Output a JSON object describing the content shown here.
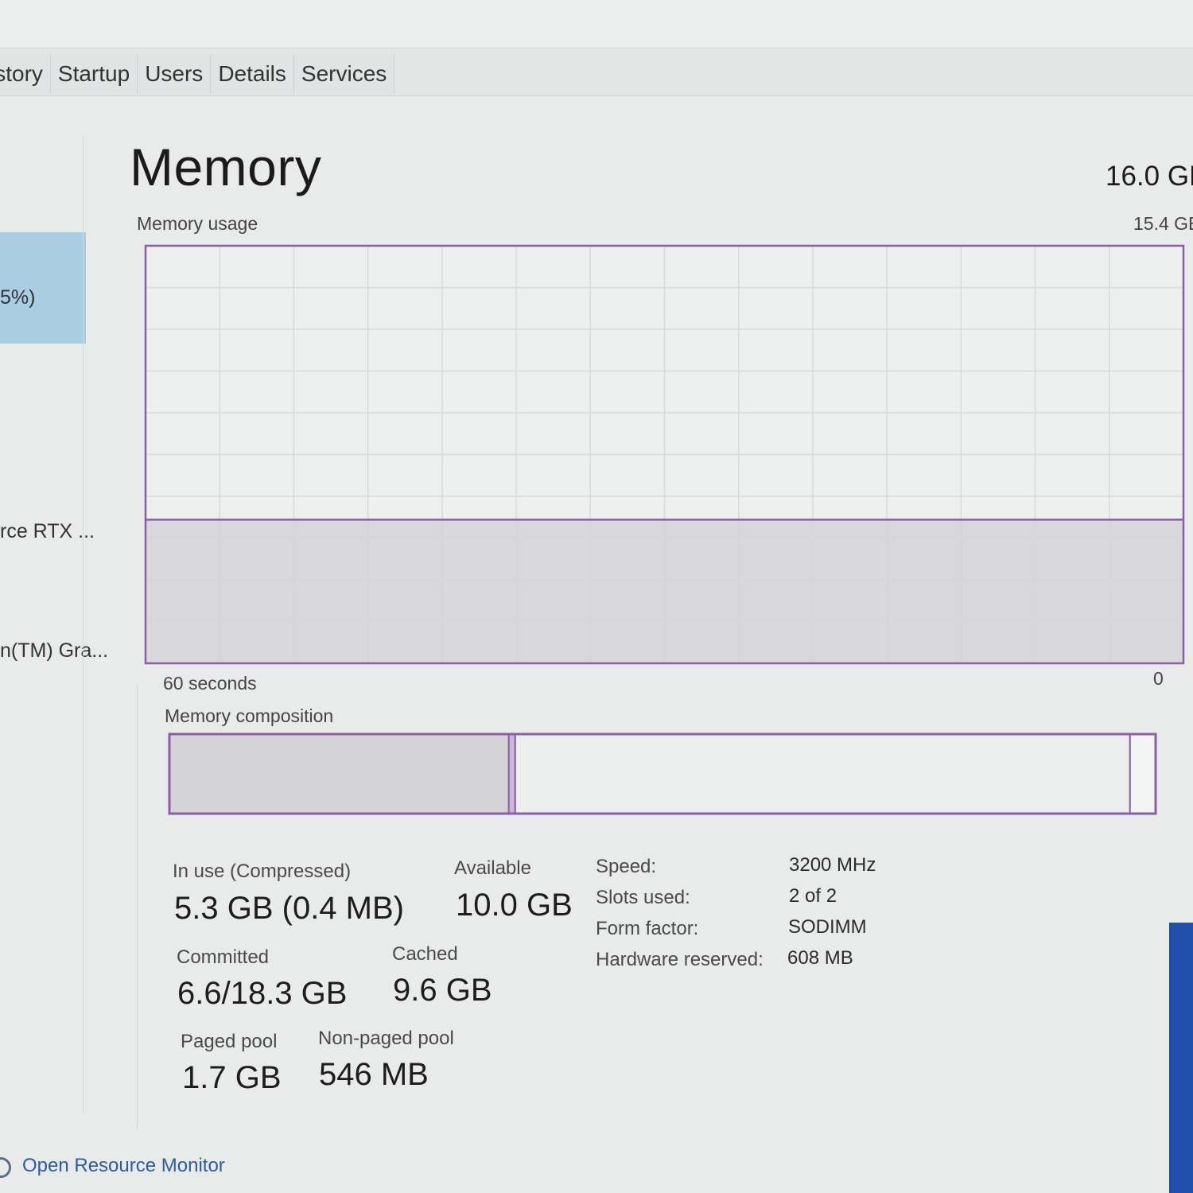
{
  "tabs": [
    "istory",
    "Startup",
    "Users",
    "Details",
    "Services"
  ],
  "sidebar": {
    "items": [
      {
        "label": "5%)"
      },
      {
        "label": "rce RTX ..."
      },
      {
        "label": "n(TM) Gra..."
      }
    ]
  },
  "main": {
    "title": "Memory",
    "total": "16.0 GB",
    "usage_label": "Memory usage",
    "usage_max": "15.4 GB",
    "time_left": "60 seconds",
    "time_right": "0",
    "composition_label": "Memory composition"
  },
  "chart_data": {
    "type": "area",
    "title": "Memory usage",
    "ylim": [
      0,
      15.4
    ],
    "x": [
      60,
      50,
      40,
      30,
      20,
      10,
      0
    ],
    "values": [
      5.3,
      5.3,
      5.3,
      5.3,
      5.3,
      5.3,
      5.3
    ],
    "xlabel": "",
    "ylabel": "",
    "grid": true
  },
  "composition": {
    "in_use_gb": 5.3,
    "modified_gb": 0.1,
    "standby_gb": 9.6,
    "free_gb": 0.4,
    "total_gb": 15.4
  },
  "stats": {
    "in_use_label": "In use (Compressed)",
    "in_use_value": "5.3 GB (0.4 MB)",
    "available_label": "Available",
    "available_value": "10.0 GB",
    "committed_label": "Committed",
    "committed_value": "6.6/18.3 GB",
    "cached_label": "Cached",
    "cached_value": "9.6 GB",
    "paged_label": "Paged pool",
    "paged_value": "1.7 GB",
    "nonpaged_label": "Non-paged pool",
    "nonpaged_value": "546 MB"
  },
  "specs": {
    "speed_label": "Speed:",
    "speed_value": "3200 MHz",
    "slots_label": "Slots used:",
    "slots_value": "2 of 2",
    "form_label": "Form factor:",
    "form_value": "SODIMM",
    "hw_label": "Hardware reserved:",
    "hw_value": "608 MB"
  },
  "footer": {
    "link_label": "Open Resource Monitor"
  },
  "colors": {
    "accent": "#8b5fa8",
    "fill": "#d4d3d6",
    "grid": "#d8dadb",
    "selected": "#a9cde3"
  }
}
